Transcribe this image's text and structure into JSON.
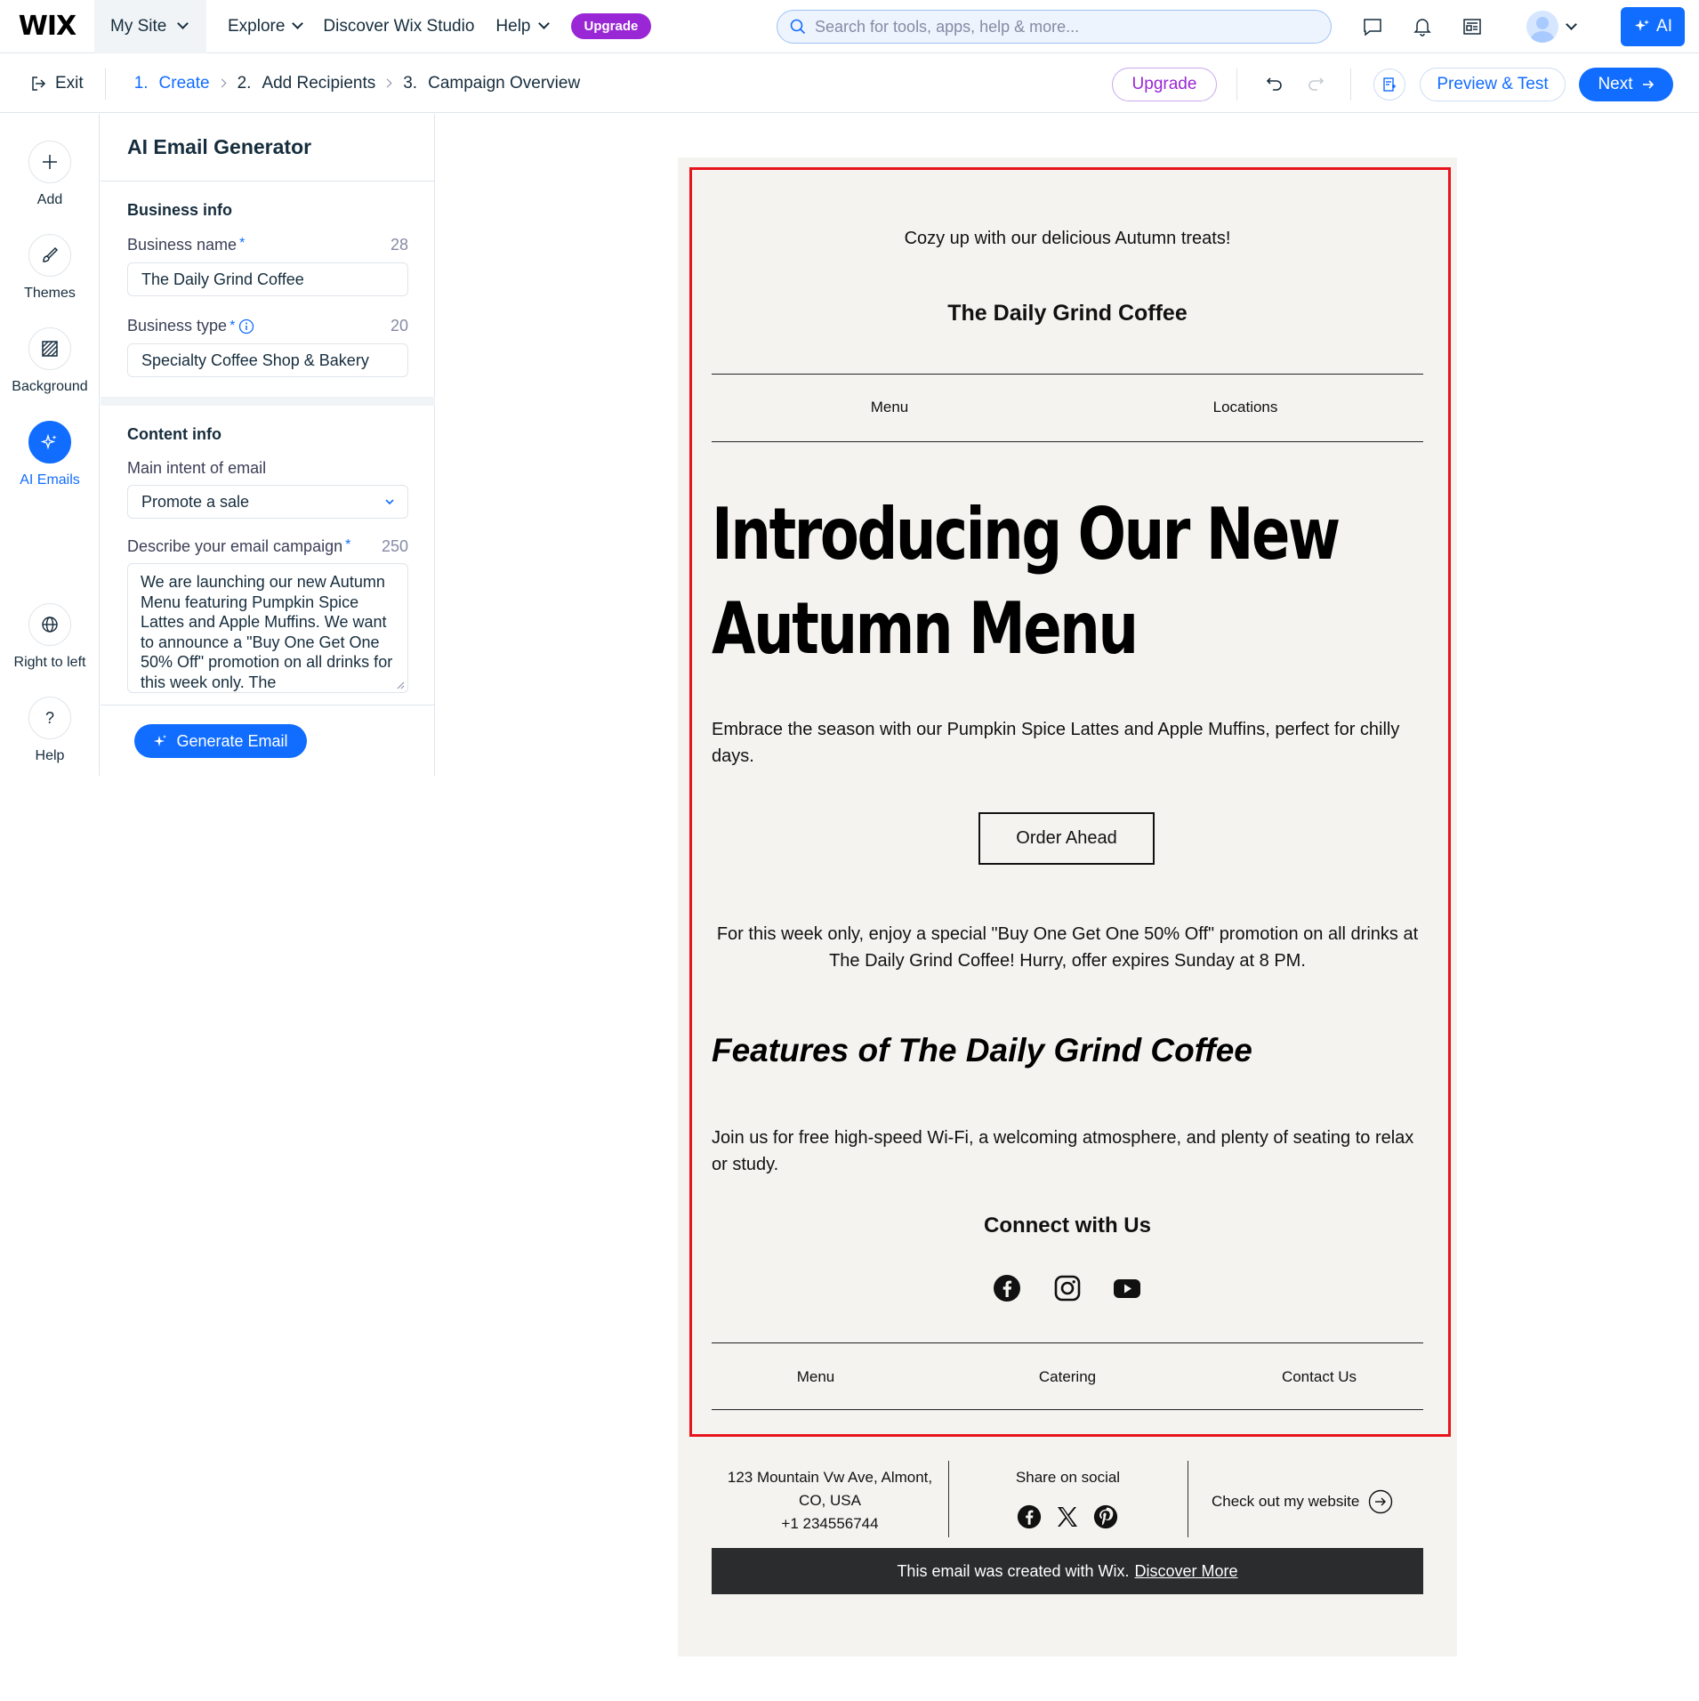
{
  "topbar": {
    "logo": "WIX",
    "site_menu": "My Site",
    "nav": [
      "Explore",
      "Discover Wix Studio",
      "Help"
    ],
    "upgrade_pill": "Upgrade",
    "search_placeholder": "Search for tools, apps, help & more...",
    "ai_button": "AI"
  },
  "subbar": {
    "exit": "Exit",
    "steps": [
      {
        "num": "1.",
        "label": "Create"
      },
      {
        "num": "2.",
        "label": "Add Recipients"
      },
      {
        "num": "3.",
        "label": "Campaign Overview"
      }
    ],
    "upgrade": "Upgrade",
    "preview": "Preview & Test",
    "next": "Next"
  },
  "rail": {
    "items": [
      "Add",
      "Themes",
      "Background",
      "AI Emails",
      "Right to left",
      "Help"
    ]
  },
  "panel": {
    "title": "AI Email Generator",
    "business_info": "Business info",
    "business_name_label": "Business name",
    "business_name_count": "28",
    "business_name_value": "The Daily Grind Coffee",
    "business_type_label": "Business type",
    "business_type_count": "20",
    "business_type_value": "Specialty Coffee Shop & Bakery",
    "content_info": "Content info",
    "intent_label": "Main intent of email",
    "intent_value": "Promote a sale",
    "describe_label": "Describe your email campaign",
    "describe_count": "250",
    "describe_value": "We are launching our new Autumn Menu featuring Pumpkin Spice Lattes and Apple Muffins. We want to announce a \"Buy One Get One 50% Off\" promotion on all drinks for this week only. The",
    "generate_button": "Generate Email"
  },
  "email": {
    "preheader": "Cozy up with our delicious Autumn treats!",
    "brand": "The Daily Grind Coffee",
    "top_nav": [
      "Menu",
      "Locations"
    ],
    "headline": "Introducing Our New Autumn Menu",
    "intro": "Embrace the season with our Pumpkin Spice Lattes and Apple Muffins, perfect for chilly days.",
    "cta": "Order Ahead",
    "promo": "For this week only, enjoy a special \"Buy One Get One 50% Off\" promotion on all drinks at The Daily Grind Coffee! Hurry, offer expires Sunday at 8 PM.",
    "features_title": "Features of The Daily Grind Coffee",
    "features_body": "Join us for free high-speed Wi-Fi, a welcoming atmosphere, and plenty of seating to relax or study.",
    "connect_title": "Connect with Us",
    "social_icons": [
      "facebook-icon",
      "instagram-icon",
      "youtube-icon"
    ],
    "bottom_nav": [
      "Menu",
      "Catering",
      "Contact Us"
    ],
    "footer": {
      "address_line1": "123 Mountain Vw Ave, Almont,",
      "address_line2": "CO, USA",
      "phone": "+1 234556744",
      "share": "Share on social",
      "share_icons": [
        "facebook-icon",
        "x-icon",
        "pinterest-icon"
      ],
      "website": "Check out my website",
      "wix_note": "This email was created with Wix.",
      "wix_link": "Discover More"
    }
  },
  "colors": {
    "wix_blue": "#116dff",
    "upgrade_purple": "#9a27d5",
    "selection_red": "#e8141c",
    "canvas_bg": "#f4f3f0"
  }
}
